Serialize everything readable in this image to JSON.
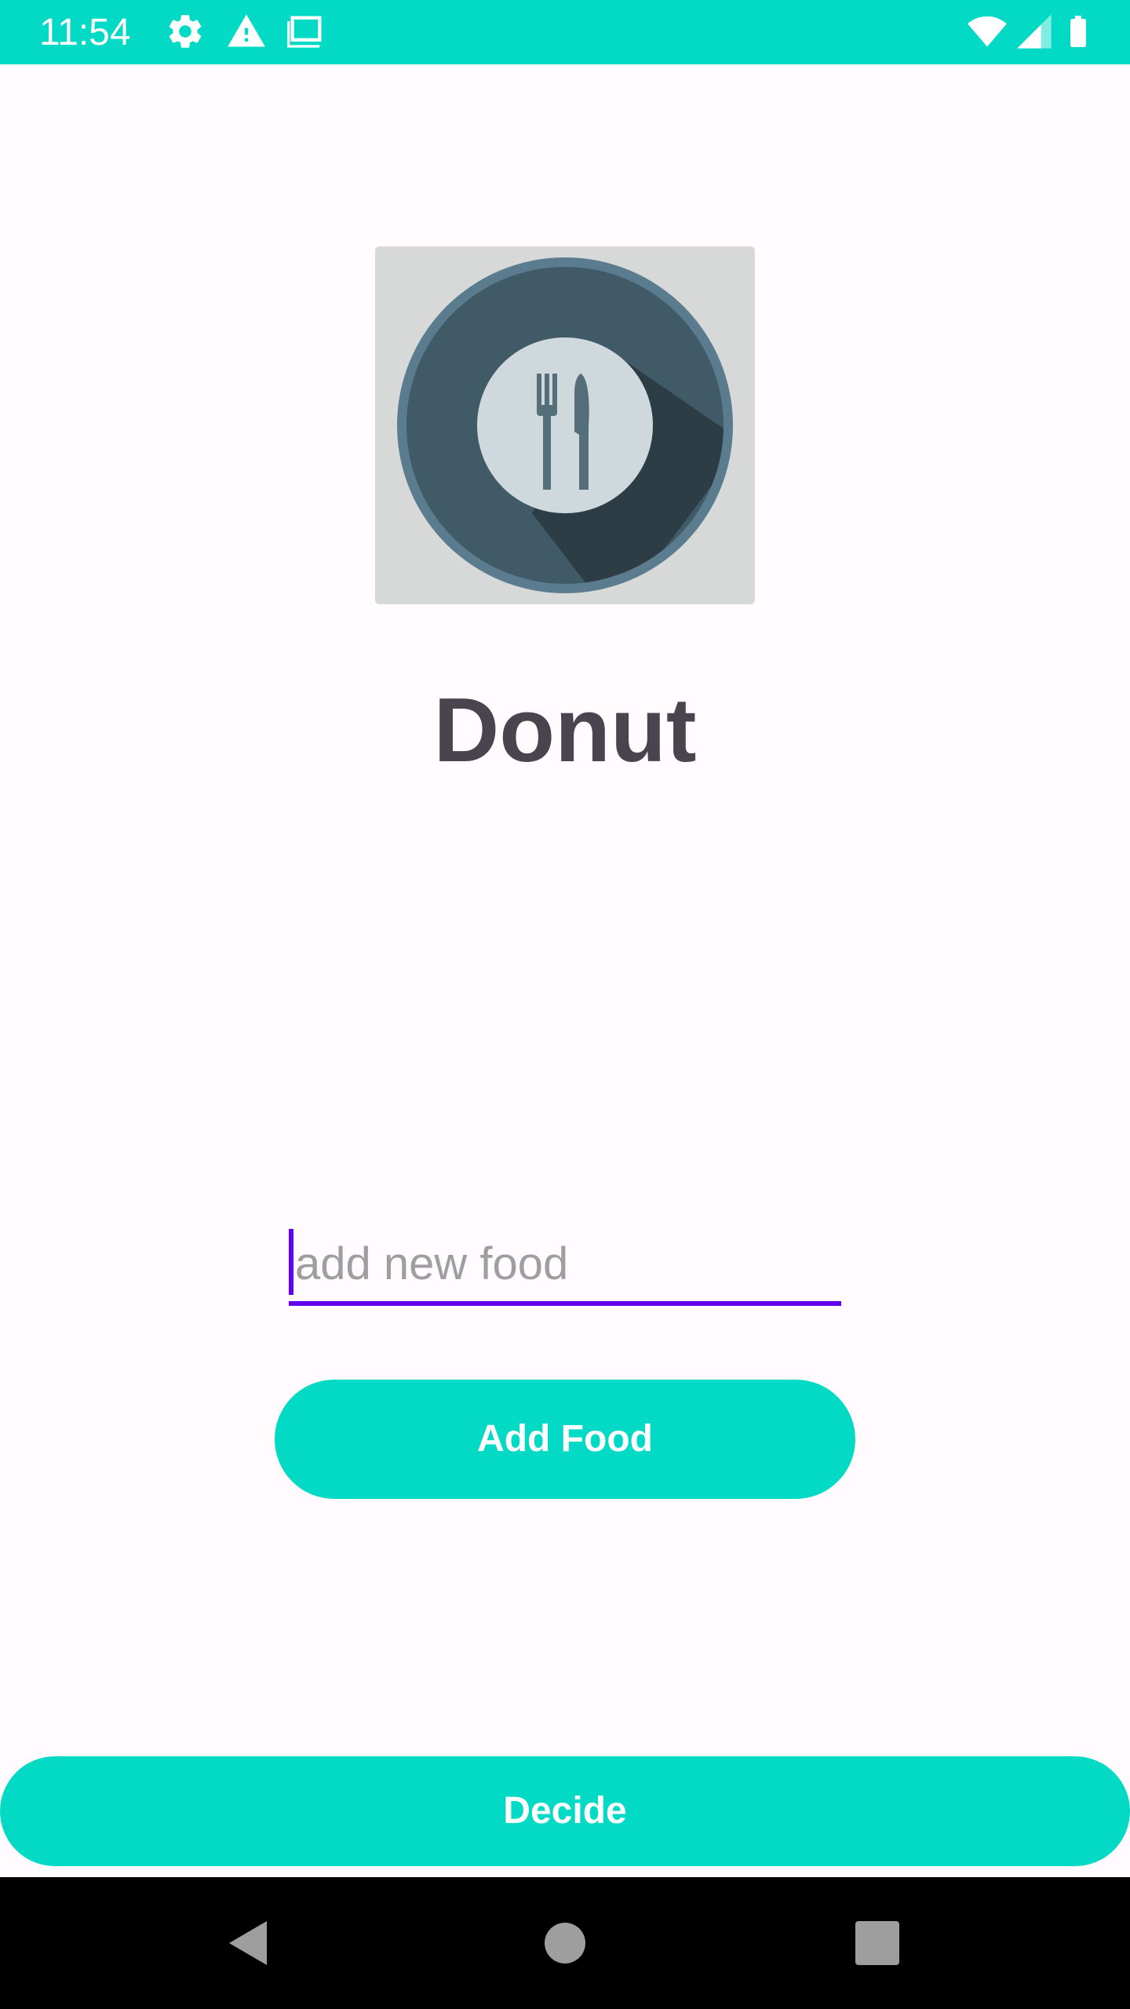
{
  "status_bar": {
    "time": "11:54",
    "background_color": "#03dac5",
    "left_icons": [
      "gear-icon",
      "warning-icon",
      "mail-icon"
    ],
    "right_icons": [
      "wifi-icon",
      "signal-icon",
      "battery-icon"
    ]
  },
  "main": {
    "image_icon": "restaurant-plate-icon",
    "food_name": "Donut",
    "input": {
      "value": "",
      "placeholder": "add new food"
    },
    "add_button_label": "Add Food",
    "decide_button_label": "Decide"
  },
  "nav_bar": {
    "buttons": [
      "back-icon",
      "home-icon",
      "recents-icon"
    ]
  },
  "colors": {
    "accent": "#03dac5",
    "input_focus": "#6200ee",
    "title_text": "#49454f"
  }
}
